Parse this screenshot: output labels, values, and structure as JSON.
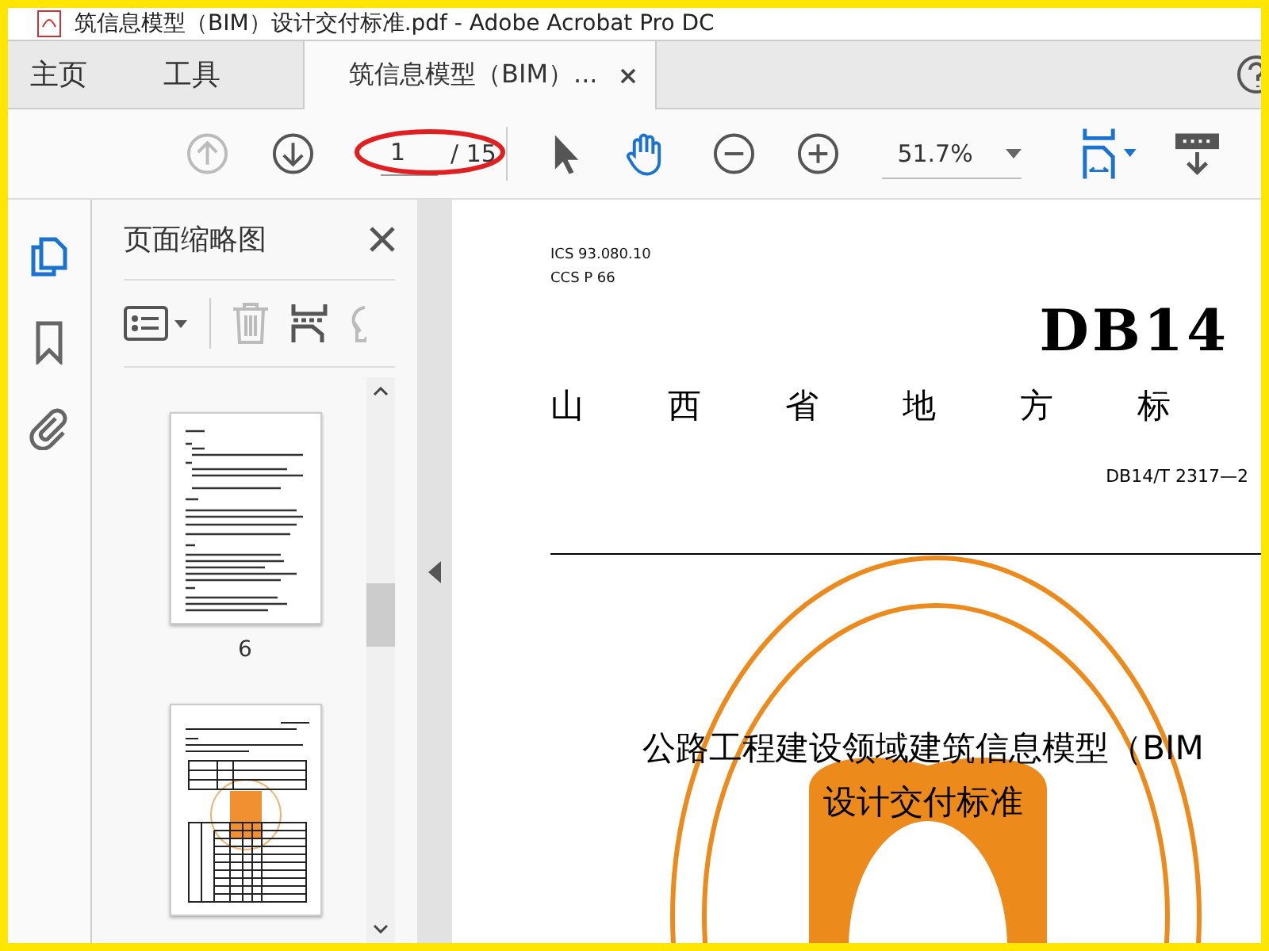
{
  "window": {
    "title": "筑信息模型（BIM）设计交付标准.pdf - Adobe Acrobat Pro DC"
  },
  "tabs": [
    {
      "label": "主页",
      "selected": false
    },
    {
      "label": "工具",
      "selected": false
    },
    {
      "label": "筑信息模型（BIM）...",
      "selected": true
    }
  ],
  "toolbar": {
    "prev_page": {
      "disabled": true
    },
    "next_page": {
      "disabled": false
    },
    "page_number": "1",
    "page_total": "/ 15",
    "tools": [
      {
        "kind": "select",
        "selected": false
      },
      {
        "kind": "hand",
        "selected": true
      }
    ],
    "zoom": "51.7%"
  },
  "rail": [
    {
      "kind": "pages",
      "selected": true
    },
    {
      "kind": "bookmarks",
      "selected": false
    },
    {
      "kind": "attachments",
      "selected": false
    }
  ],
  "panel": {
    "title": "页面缩略图",
    "thumbnails": [
      {
        "kind": "text",
        "page_label": "6"
      },
      {
        "kind": "table"
      }
    ]
  },
  "document": {
    "ics": "ICS  93.080.10",
    "ccs": "CCS  P 66",
    "code": "DB14",
    "authority": [
      "山",
      "西",
      "省",
      "地",
      "方",
      "标"
    ],
    "number": "DB14/T 2317—2",
    "title_lines": [
      "公路工程建设领域建筑信息模型（BIM",
      "设计交付标准"
    ]
  }
}
